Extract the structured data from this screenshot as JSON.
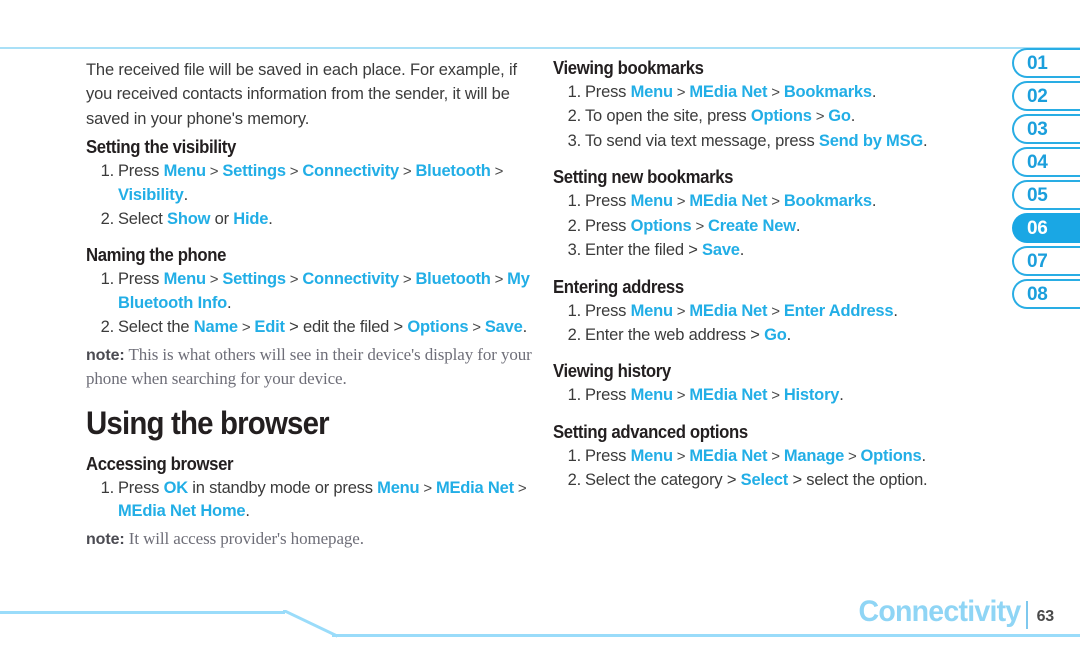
{
  "document": {
    "footer_section": "Connectivity",
    "page_number": "63",
    "accent_color": "#22aee6",
    "rule_color": "#9adcfa"
  },
  "tabs": {
    "items": [
      {
        "label": "01",
        "active": false
      },
      {
        "label": "02",
        "active": false
      },
      {
        "label": "03",
        "active": false
      },
      {
        "label": "04",
        "active": false
      },
      {
        "label": "05",
        "active": false
      },
      {
        "label": "06",
        "active": true
      },
      {
        "label": "07",
        "active": false
      },
      {
        "label": "08",
        "active": false
      }
    ]
  },
  "left_column": {
    "intro_paragraph": "The received file will be saved in each place. For example, if you received contacts information from the sender, it will be saved in your phone's memory.",
    "sections": [
      {
        "heading": "Setting the visibility",
        "steps": [
          {
            "parts": [
              {
                "t": "Press ",
                "k": false
              },
              {
                "t": "Menu",
                "k": true
              },
              {
                "t": " > ",
                "k": false
              },
              {
                "t": "Settings",
                "k": true
              },
              {
                "t": " > ",
                "k": false
              },
              {
                "t": "Connectivity",
                "k": true
              },
              {
                "t": " > ",
                "k": false
              },
              {
                "t": "Bluetooth",
                "k": true
              },
              {
                "t": " > ",
                "k": false
              },
              {
                "t": "Visibility",
                "k": true
              },
              {
                "t": ".",
                "k": false
              }
            ]
          },
          {
            "parts": [
              {
                "t": "Select ",
                "k": false
              },
              {
                "t": "Show",
                "k": true
              },
              {
                "t": " or ",
                "k": false
              },
              {
                "t": "Hide",
                "k": true
              },
              {
                "t": ".",
                "k": false
              }
            ]
          }
        ]
      },
      {
        "heading": "Naming the phone",
        "steps": [
          {
            "parts": [
              {
                "t": "Press ",
                "k": false
              },
              {
                "t": "Menu",
                "k": true
              },
              {
                "t": " > ",
                "k": false
              },
              {
                "t": "Settings",
                "k": true
              },
              {
                "t": " > ",
                "k": false
              },
              {
                "t": "Connectivity",
                "k": true
              },
              {
                "t": " > ",
                "k": false
              },
              {
                "t": "Bluetooth",
                "k": true
              },
              {
                "t": " > ",
                "k": false
              },
              {
                "t": "My Bluetooth Info",
                "k": true
              },
              {
                "t": ".",
                "k": false
              }
            ]
          },
          {
            "parts": [
              {
                "t": "Select the ",
                "k": false
              },
              {
                "t": "Name",
                "k": true
              },
              {
                "t": " > ",
                "k": false
              },
              {
                "t": "Edit",
                "k": true
              },
              {
                "t": " > edit the filed > ",
                "k": false
              },
              {
                "t": "Options",
                "k": true
              },
              {
                "t": " > ",
                "k": false
              },
              {
                "t": "Save",
                "k": true
              },
              {
                "t": ".",
                "k": false
              }
            ]
          }
        ],
        "note": {
          "label": "note:",
          "text": "This is what others will see in their device's display for your phone when searching for your device."
        }
      }
    ],
    "chapter_heading": "Using the browser",
    "sections_after": [
      {
        "heading": "Accessing browser",
        "steps": [
          {
            "parts": [
              {
                "t": "Press ",
                "k": false
              },
              {
                "t": "OK",
                "k": true
              },
              {
                "t": " in standby mode or press ",
                "k": false
              },
              {
                "t": "Menu",
                "k": true
              },
              {
                "t": " > ",
                "k": false
              },
              {
                "t": "MEdia Net",
                "k": true
              },
              {
                "t": " > ",
                "k": false
              },
              {
                "t": "MEdia Net Home",
                "k": true
              },
              {
                "t": ".",
                "k": false
              }
            ]
          }
        ],
        "note": {
          "label": "note:",
          "text": "It will access provider's homepage."
        }
      }
    ]
  },
  "right_column": {
    "sections": [
      {
        "heading": "Viewing bookmarks",
        "steps": [
          {
            "parts": [
              {
                "t": "Press ",
                "k": false
              },
              {
                "t": "Menu",
                "k": true
              },
              {
                "t": " > ",
                "k": false
              },
              {
                "t": "MEdia Net",
                "k": true
              },
              {
                "t": " > ",
                "k": false
              },
              {
                "t": "Bookmarks",
                "k": true
              },
              {
                "t": ".",
                "k": false
              }
            ]
          },
          {
            "parts": [
              {
                "t": "To open the site, press ",
                "k": false
              },
              {
                "t": "Options",
                "k": true
              },
              {
                "t": " > ",
                "k": false
              },
              {
                "t": "Go",
                "k": true
              },
              {
                "t": ".",
                "k": false
              }
            ]
          },
          {
            "parts": [
              {
                "t": "To send via text message, press ",
                "k": false
              },
              {
                "t": "Send by MSG",
                "k": true
              },
              {
                "t": ".",
                "k": false
              }
            ]
          }
        ]
      },
      {
        "heading": "Setting new bookmarks",
        "steps": [
          {
            "parts": [
              {
                "t": "Press ",
                "k": false
              },
              {
                "t": "Menu",
                "k": true
              },
              {
                "t": " > ",
                "k": false
              },
              {
                "t": "MEdia Net",
                "k": true
              },
              {
                "t": " > ",
                "k": false
              },
              {
                "t": "Bookmarks",
                "k": true
              },
              {
                "t": ".",
                "k": false
              }
            ]
          },
          {
            "parts": [
              {
                "t": "Press ",
                "k": false
              },
              {
                "t": "Options",
                "k": true
              },
              {
                "t": " > ",
                "k": false
              },
              {
                "t": "Create New",
                "k": true
              },
              {
                "t": ".",
                "k": false
              }
            ]
          },
          {
            "parts": [
              {
                "t": "Enter the filed > ",
                "k": false
              },
              {
                "t": "Save",
                "k": true
              },
              {
                "t": ".",
                "k": false
              }
            ]
          }
        ]
      },
      {
        "heading": "Entering address",
        "steps": [
          {
            "parts": [
              {
                "t": "Press ",
                "k": false
              },
              {
                "t": "Menu",
                "k": true
              },
              {
                "t": " > ",
                "k": false
              },
              {
                "t": "MEdia Net",
                "k": true
              },
              {
                "t": " > ",
                "k": false
              },
              {
                "t": "Enter Address",
                "k": true
              },
              {
                "t": ".",
                "k": false
              }
            ]
          },
          {
            "parts": [
              {
                "t": "Enter the web address > ",
                "k": false
              },
              {
                "t": "Go",
                "k": true
              },
              {
                "t": ".",
                "k": false
              }
            ]
          }
        ]
      },
      {
        "heading": "Viewing history",
        "steps": [
          {
            "parts": [
              {
                "t": "Press ",
                "k": false
              },
              {
                "t": "Menu",
                "k": true
              },
              {
                "t": " > ",
                "k": false
              },
              {
                "t": "MEdia Net",
                "k": true
              },
              {
                "t": " > ",
                "k": false
              },
              {
                "t": "History",
                "k": true
              },
              {
                "t": ".",
                "k": false
              }
            ]
          }
        ]
      },
      {
        "heading": "Setting advanced options",
        "steps": [
          {
            "parts": [
              {
                "t": "Press ",
                "k": false
              },
              {
                "t": "Menu",
                "k": true
              },
              {
                "t": " > ",
                "k": false
              },
              {
                "t": "MEdia Net",
                "k": true
              },
              {
                "t": " > ",
                "k": false
              },
              {
                "t": "Manage",
                "k": true
              },
              {
                "t": " > ",
                "k": false
              },
              {
                "t": "Options",
                "k": true
              },
              {
                "t": ".",
                "k": false
              }
            ]
          },
          {
            "parts": [
              {
                "t": "Select the category > ",
                "k": false
              },
              {
                "t": "Select",
                "k": true
              },
              {
                "t": " > select the option.",
                "k": false
              }
            ]
          }
        ]
      }
    ]
  }
}
